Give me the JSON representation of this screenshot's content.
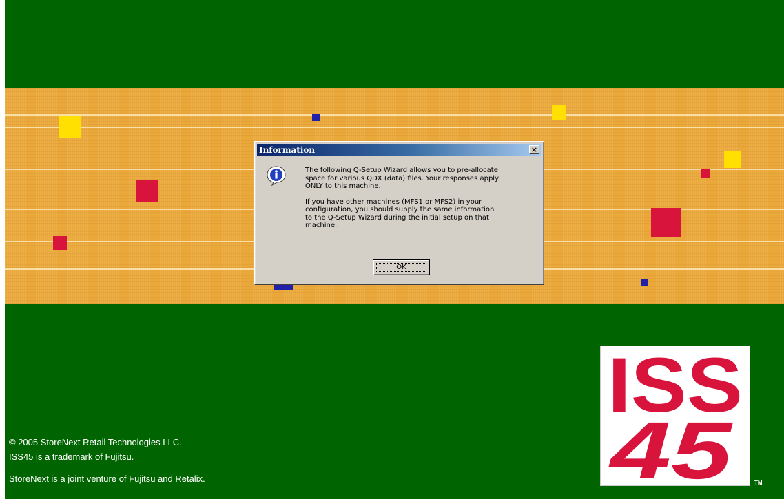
{
  "dialog": {
    "title": "Information",
    "close_glyph": "×",
    "icon": "info-icon",
    "message_1": "The following Q-Setup Wizard allows you to pre-allocate\nspace for various QDX (data) files.  Your responses apply\nONLY to this machine.",
    "message_2": "If you have other machines (MFS1 or MFS2) in your\nconfiguration, you should supply the same information\nto the Q-Setup Wizard during the initial setup on that\nmachine.",
    "ok_label": "OK"
  },
  "footer": {
    "copyright": "© 2005 StoreNext Retail Technologies LLC.",
    "trademark": "ISS45 is a trademark of Fujitsu.",
    "venture": "StoreNext is a joint venture of Fujitsu and Retalix."
  },
  "logo": {
    "line1": "ISS",
    "line2": "45",
    "tm": "TM"
  },
  "colors": {
    "background_green": "#006400",
    "band_orange": "#eba83a",
    "logo_red": "#d8143c",
    "title_blue": "#0a246a"
  }
}
